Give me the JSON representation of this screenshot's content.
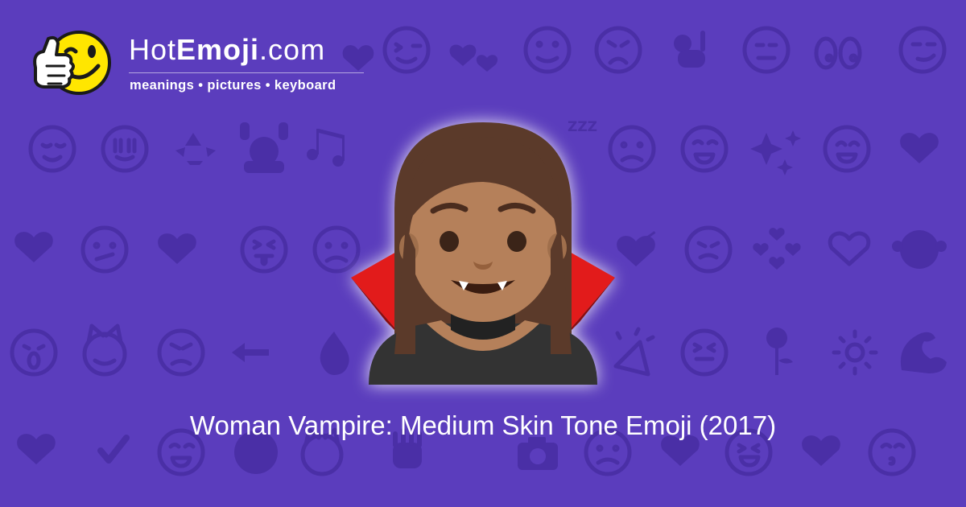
{
  "colors": {
    "background": "#5b3dbd",
    "pattern_glyph": "#4a2fa6",
    "text": "#ffffff",
    "logo_face": "#ffe600",
    "cape_red": "#e21b1b",
    "hair": "#5b3a2a",
    "skin": "#b5805a",
    "clothing": "#333333"
  },
  "logo": {
    "name_prefix": "Hot",
    "name_bold": "Emoji",
    "name_suffix": ".com",
    "tagline": "meanings • pictures • keyboard",
    "mascot_icon": "winking-thumbs-up-face-icon"
  },
  "main_emoji": {
    "icon": "woman-vampire-medium-skin-tone-icon"
  },
  "caption": "Woman Vampire: Medium Skin Tone Emoji (2017)",
  "background_pattern_icons": [
    "heart-icon",
    "winking-face-icon",
    "face-blowing-kiss-icon",
    "two-hearts-icon",
    "smiling-face-icon",
    "weary-face-icon",
    "ok-hand-icon",
    "expressionless-face-icon",
    "eyes-icon",
    "smirking-face-icon",
    "relieved-face-icon",
    "grinning-squinting-face-icon",
    "recycling-symbol-icon",
    "raising-hands-icon",
    "musical-notes-icon",
    "zzz-icon",
    "worried-face-icon",
    "sparkles-icon",
    "heart-suit-icon",
    "broken-heart-icon",
    "confused-face-icon",
    "striped-heart-icon",
    "squinting-tongue-face-icon",
    "frowning-face-icon",
    "heart-with-arrow-icon",
    "persevering-face-icon",
    "smiling-face-with-hearts-icon",
    "see-no-evil-monkey-icon",
    "face-screaming-icon",
    "smiling-cat-icon",
    "angry-face-icon",
    "left-arrow-icon",
    "fire-icon",
    "party-popper-icon",
    "rose-icon",
    "sun-icon",
    "flexed-biceps-icon",
    "check-mark-icon",
    "grinning-face-icon",
    "camera-icon",
    "kissing-face-icon"
  ]
}
